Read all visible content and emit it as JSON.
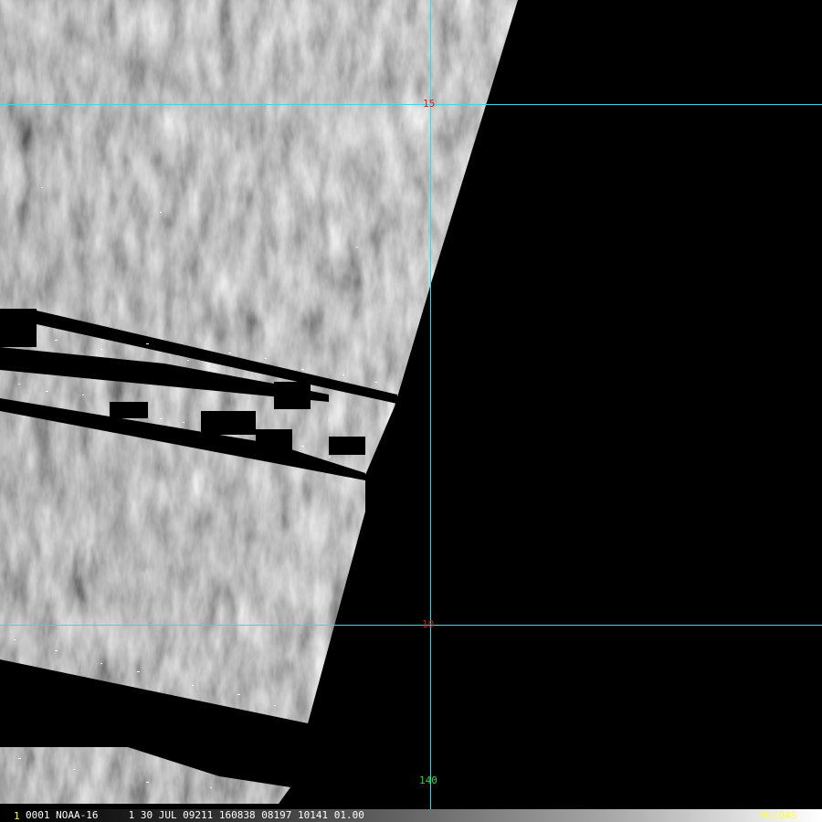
{
  "map": {
    "grid_labels": {
      "lat_north": "15",
      "lat_south": "10",
      "lon": "140"
    },
    "colors": {
      "grid_line": "#3fd7dc",
      "lat_label": "#c0202a",
      "lon_label": "#22dd33",
      "status_highlight": "#ffff33"
    }
  },
  "status_bar": {
    "frame_number": "1",
    "info": "0001 NOAA-16     1 30 JUL 09211 160838 08197 10141 01.00",
    "brand": "McIDAS"
  }
}
